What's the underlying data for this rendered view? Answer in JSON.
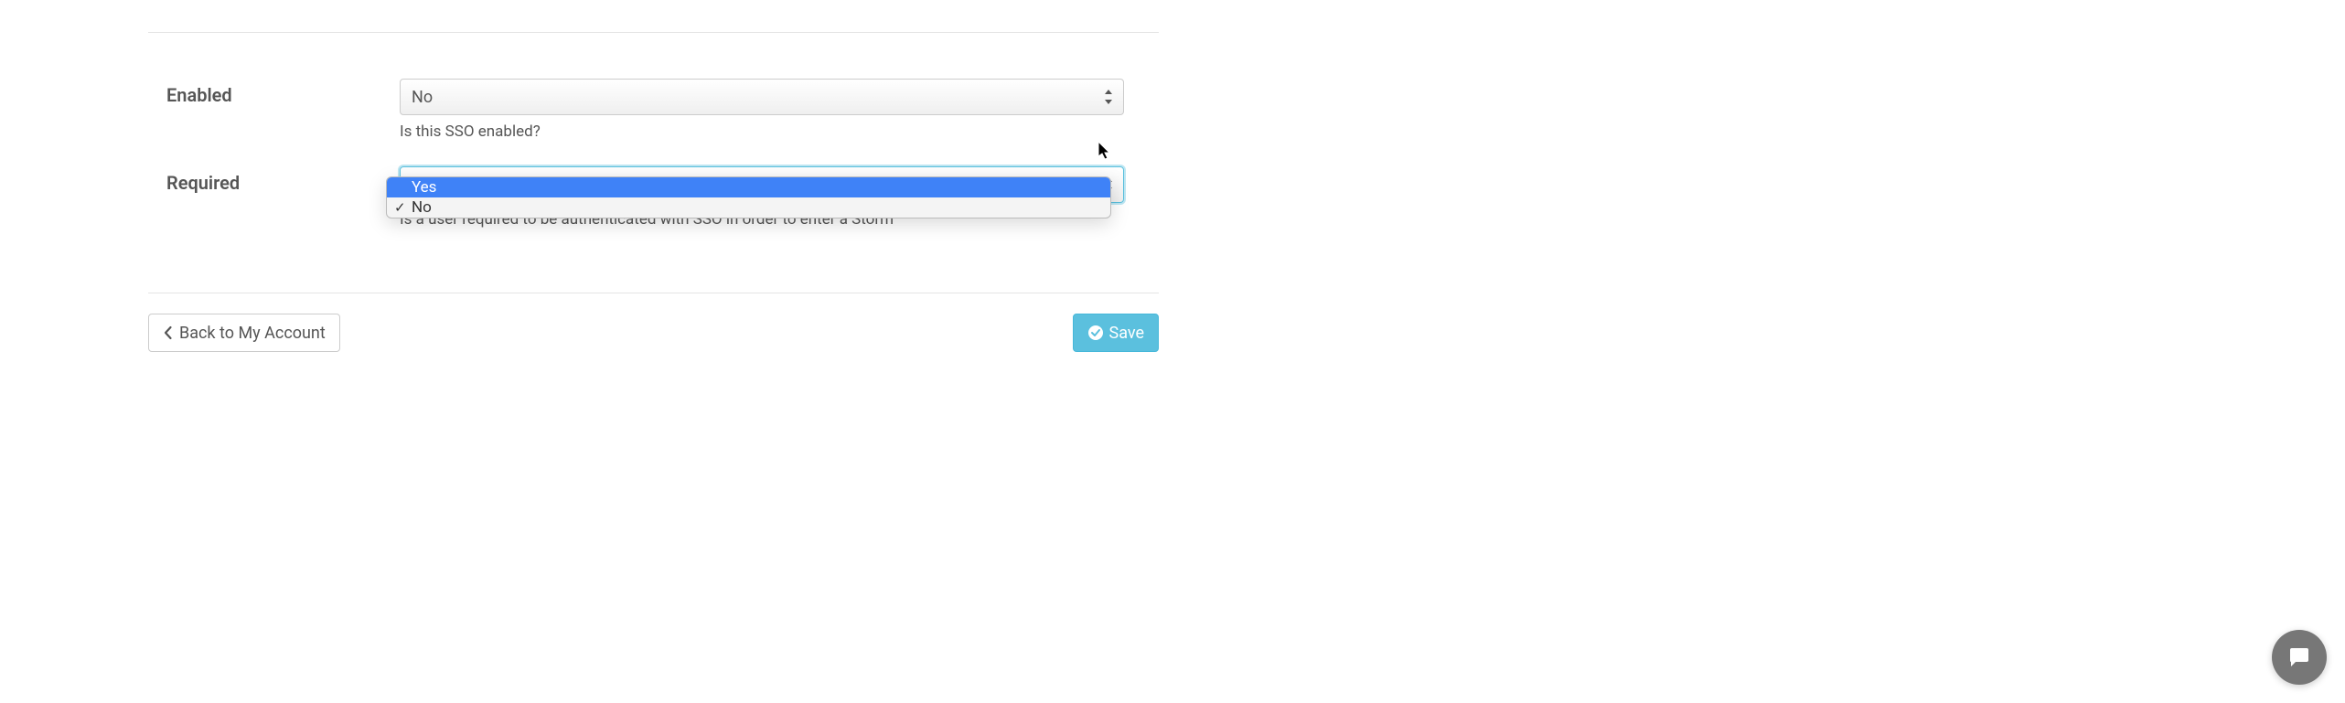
{
  "form": {
    "enabled": {
      "label": "Enabled",
      "value": "No",
      "help": "Is this SSO enabled?"
    },
    "required": {
      "label": "Required",
      "value": "No",
      "help": "Is a user required to be authenticated with SSO in order to enter a Storm",
      "options": [
        {
          "label": "Yes",
          "selected": false,
          "highlighted": true
        },
        {
          "label": "No",
          "selected": true,
          "highlighted": false
        }
      ]
    }
  },
  "buttons": {
    "back": "Back to My Account",
    "save": "Save"
  }
}
